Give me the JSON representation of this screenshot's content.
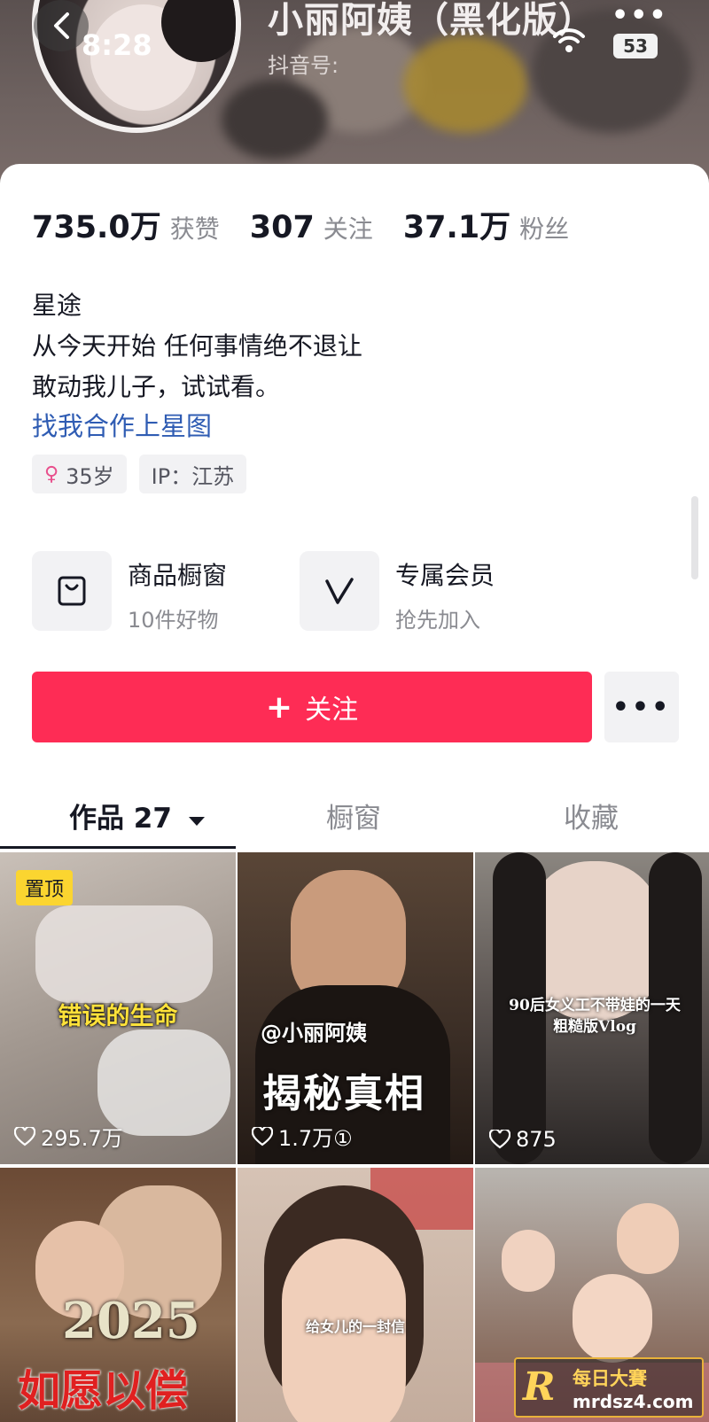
{
  "status_bar": {
    "time": "8:28",
    "battery": "53"
  },
  "profile": {
    "name": "小丽阿姨（黑化版）",
    "douyin_id_label": "抖音号:",
    "stats": [
      {
        "value": "735.0万",
        "label": "获赞"
      },
      {
        "value": "307",
        "label": "关注"
      },
      {
        "value": "37.1万",
        "label": "粉丝"
      }
    ],
    "bio": [
      "星途",
      "从今天开始 任何事情绝不退让",
      "敢动我儿子，试试看。"
    ],
    "link": "找我合作上星图",
    "tags": {
      "age": "35岁",
      "ip": "IP：江苏"
    }
  },
  "features": {
    "shop": {
      "title": "商品橱窗",
      "subtitle": "10件好物",
      "icon": "shopping-bag-icon"
    },
    "member": {
      "title": "专属会员",
      "subtitle": "抢先加入",
      "icon": "vip-v-icon"
    }
  },
  "actions": {
    "follow": "关注",
    "more": "•••"
  },
  "tabs": [
    {
      "label": "作品 27",
      "active": true
    },
    {
      "label": "橱窗",
      "active": false
    },
    {
      "label": "收藏",
      "active": false
    }
  ],
  "videos": [
    {
      "likes": "295.7万",
      "pinned": "置顶",
      "caption": "错误的生命"
    },
    {
      "likes": "1.7万①",
      "handle": "@小丽阿姨",
      "caption": "揭秘真相"
    },
    {
      "likes": "875",
      "caption": "90后女义工不带娃的一天",
      "caption2": "粗糙版Vlog"
    },
    {
      "caption": "2025",
      "caption2": "如愿以偿"
    },
    {
      "caption": "给女儿的一封信"
    },
    {}
  ],
  "watermark": {
    "line1": "每日大賽",
    "line2": "mrdsz4.com"
  },
  "colors": {
    "accent": "#fe2c55",
    "link": "#2f5cb3",
    "pin": "#fbd530"
  }
}
